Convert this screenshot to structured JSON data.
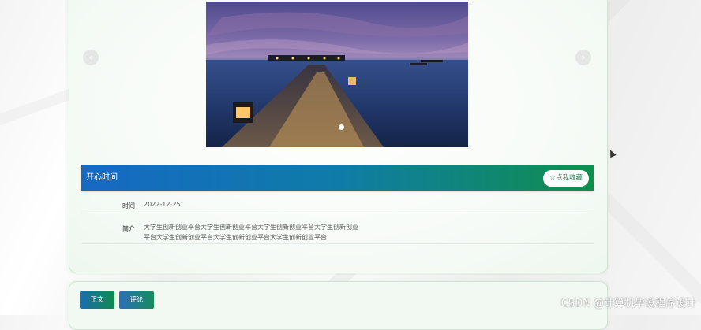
{
  "slider": {
    "prev_icon": "‹",
    "next_icon": "›",
    "image_alt": "island-pier-at-dusk-image"
  },
  "detail": {
    "title": "开心时间",
    "favorite_label": "☆点我收藏",
    "time_label": "时间",
    "time_value": "2022-12-25",
    "intro_label": "简介",
    "intro_line1": "大学生创新创业平台大学生创新创业平台大学生创新创业平台大学生创新创业",
    "intro_line2": "平台大学生创新创业平台大学生创新创业平台大学生创新创业平台"
  },
  "tabs": {
    "text_label": "正文",
    "comment_label": "评论"
  },
  "watermark": "CSDN @计算机毕设程序设计",
  "colors": {
    "accent_blue": "#1669c3",
    "accent_green": "#0e8f4c"
  }
}
